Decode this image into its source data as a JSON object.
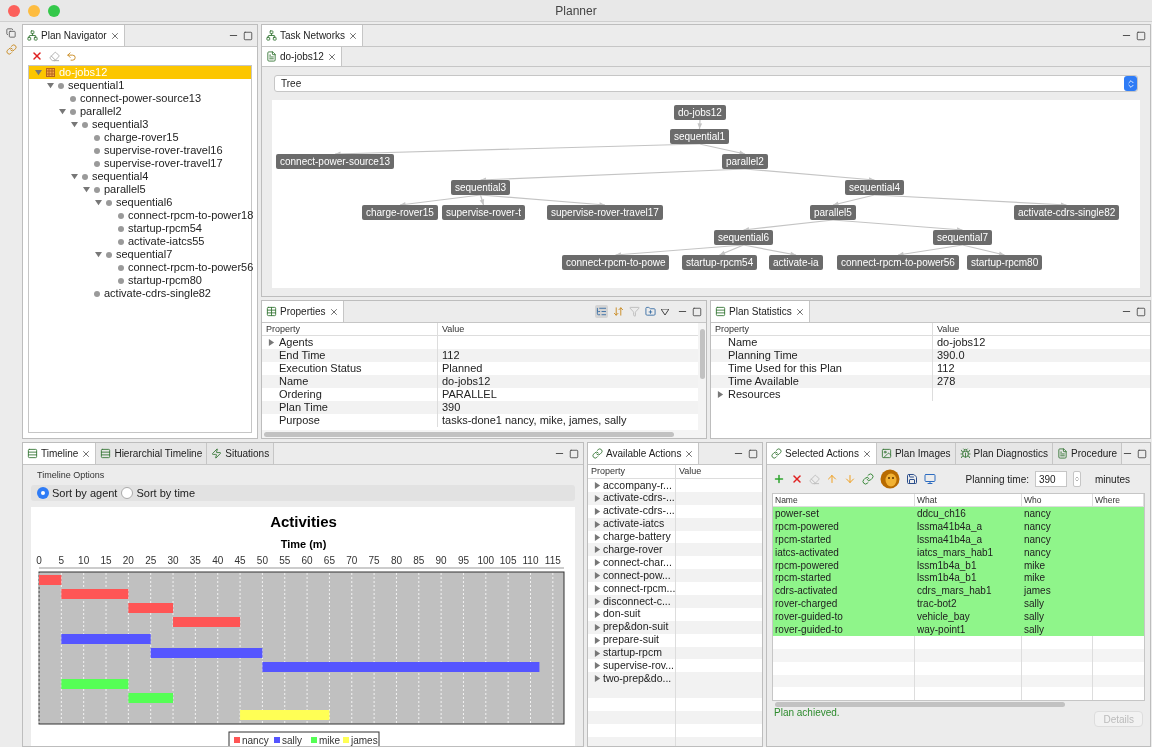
{
  "window": {
    "title": "Planner"
  },
  "plan_navigator": {
    "tabs": [
      {
        "label": "Plan Navigator",
        "selected": true
      }
    ],
    "tree": [
      {
        "label": "do-jobs12",
        "kind": "plan",
        "selected": true,
        "expanded": true,
        "children": [
          {
            "label": "sequential1",
            "kind": "task",
            "selected": false,
            "expanded": true,
            "children": [
              {
                "label": "connect-power-source13",
                "kind": "task",
                "selected": false
              },
              {
                "label": "parallel2",
                "kind": "task",
                "selected": false,
                "expanded": true,
                "children": [
                  {
                    "label": "sequential3",
                    "kind": "task",
                    "selected": false,
                    "expanded": true,
                    "children": [
                      {
                        "label": "charge-rover15",
                        "kind": "task",
                        "selected": false
                      },
                      {
                        "label": "supervise-rover-travel16",
                        "kind": "task",
                        "selected": false
                      },
                      {
                        "label": "supervise-rover-travel17",
                        "kind": "task",
                        "selected": false
                      }
                    ]
                  },
                  {
                    "label": "sequential4",
                    "kind": "task",
                    "selected": false,
                    "expanded": true,
                    "children": [
                      {
                        "label": "parallel5",
                        "kind": "task",
                        "selected": false,
                        "expanded": true,
                        "children": [
                          {
                            "label": "sequential6",
                            "kind": "task",
                            "selected": false,
                            "expanded": true,
                            "children": [
                              {
                                "label": "connect-rpcm-to-power18",
                                "kind": "task",
                                "selected": false
                              },
                              {
                                "label": "startup-rpcm54",
                                "kind": "task",
                                "selected": false
                              },
                              {
                                "label": "activate-iatcs55",
                                "kind": "task",
                                "selected": false
                              }
                            ]
                          },
                          {
                            "label": "sequential7",
                            "kind": "task",
                            "selected": false,
                            "expanded": true,
                            "children": [
                              {
                                "label": "connect-rpcm-to-power56",
                                "kind": "task",
                                "selected": false
                              },
                              {
                                "label": "startup-rpcm80",
                                "kind": "task",
                                "selected": false
                              }
                            ]
                          }
                        ]
                      },
                      {
                        "label": "activate-cdrs-single82",
                        "kind": "task",
                        "selected": false
                      }
                    ]
                  }
                ]
              }
            ]
          }
        ]
      }
    ]
  },
  "task_networks": {
    "tabs": [
      {
        "label": "Task Networks",
        "selected": true
      }
    ],
    "editor_tabs": [
      {
        "label": "do-jobs12",
        "selected": true
      }
    ],
    "view_select": {
      "value": "Tree"
    },
    "graph": {
      "label": "do-jobs12",
      "children": [
        {
          "label": "sequential1",
          "children": [
            {
              "label": "connect-power-source13"
            },
            {
              "label": "parallel2",
              "children": [
                {
                  "label": "sequential3",
                  "children": [
                    {
                      "label": "charge-rover15"
                    },
                    {
                      "label": "supervise-rover-t"
                    },
                    {
                      "label": "supervise-rover-travel17"
                    }
                  ]
                },
                {
                  "label": "sequential4",
                  "children": [
                    {
                      "label": "parallel5",
                      "children": [
                        {
                          "label": "sequential6",
                          "children": [
                            {
                              "label": "connect-rpcm-to-powe"
                            },
                            {
                              "label": "startup-rpcm54"
                            },
                            {
                              "label": "activate-ia"
                            }
                          ]
                        },
                        {
                          "label": "sequential7",
                          "children": [
                            {
                              "label": "connect-rpcm-to-power56"
                            },
                            {
                              "label": "startup-rpcm80"
                            }
                          ]
                        }
                      ]
                    },
                    {
                      "label": "activate-cdrs-single82"
                    }
                  ]
                }
              ]
            }
          ]
        }
      ]
    }
  },
  "properties": {
    "tabs": [
      {
        "label": "Properties",
        "selected": true
      }
    ],
    "columns": [
      "Property",
      "Value"
    ],
    "rows": [
      {
        "kind": "group",
        "property": "Agents",
        "expanded": false
      },
      {
        "kind": "field",
        "property": "End Time",
        "value": "112"
      },
      {
        "kind": "field",
        "property": "Execution Status",
        "value": "Planned"
      },
      {
        "kind": "field",
        "property": "Name",
        "value": "do-jobs12"
      },
      {
        "kind": "field",
        "property": "Ordering",
        "value": "PARALLEL"
      },
      {
        "kind": "field",
        "property": "Plan Time",
        "value": "390"
      },
      {
        "kind": "field",
        "property": "Purpose",
        "value": "tasks-done1 nancy, mike, james, sally"
      }
    ]
  },
  "plan_statistics": {
    "tabs": [
      {
        "label": "Plan Statistics",
        "selected": true
      }
    ],
    "columns": [
      "Property",
      "Value"
    ],
    "rows": [
      {
        "kind": "field",
        "property": "Name",
        "value": "do-jobs12"
      },
      {
        "kind": "field",
        "property": "Planning Time",
        "value": "390.0"
      },
      {
        "kind": "field",
        "property": "Time Used for this Plan",
        "value": "112"
      },
      {
        "kind": "field",
        "property": "Time Available",
        "value": "278"
      },
      {
        "kind": "group",
        "property": "Resources",
        "expanded": false
      }
    ]
  },
  "timeline": {
    "tabs": [
      {
        "label": "Timeline",
        "selected": true
      },
      {
        "label": "Hierarchial Timeline",
        "selected": false
      },
      {
        "label": "Situations",
        "selected": false
      }
    ],
    "options_label": "Timeline Options",
    "sort_options": [
      {
        "label": "Sort by agent",
        "selected": true
      },
      {
        "label": "Sort by time",
        "selected": false
      }
    ],
    "chart": {
      "title": "Activities",
      "axis_title": "Time (m)",
      "ticks": [
        "0",
        "5",
        "10",
        "15",
        "20",
        "25",
        "30",
        "35",
        "40",
        "45",
        "50",
        "55",
        "60",
        "65",
        "70",
        "75",
        "80",
        "85",
        "90",
        "95",
        "100",
        "105",
        "110",
        "115"
      ],
      "legend": [
        {
          "name": "nancy",
          "color": "#ff5555"
        },
        {
          "name": "sally",
          "color": "#5555ff"
        },
        {
          "name": "mike",
          "color": "#55ff55"
        },
        {
          "name": "james",
          "color": "#ffff55"
        }
      ]
    }
  },
  "available_actions": {
    "tabs": [
      {
        "label": "Available Actions",
        "selected": true
      }
    ],
    "columns": [
      "Property",
      "Value"
    ],
    "items": [
      {
        "label": "accompany-r...",
        "expanded": false
      },
      {
        "label": "activate-cdrs-...",
        "expanded": false
      },
      {
        "label": "activate-cdrs-...",
        "expanded": false
      },
      {
        "label": "activate-iatcs",
        "expanded": false
      },
      {
        "label": "charge-battery",
        "expanded": false
      },
      {
        "label": "charge-rover",
        "expanded": false
      },
      {
        "label": "connect-char...",
        "expanded": false
      },
      {
        "label": "connect-pow...",
        "expanded": false
      },
      {
        "label": "connect-rpcm...",
        "expanded": false
      },
      {
        "label": "disconnect-c...",
        "expanded": false
      },
      {
        "label": "don-suit",
        "expanded": false
      },
      {
        "label": "prep&don-suit",
        "expanded": false
      },
      {
        "label": "prepare-suit",
        "expanded": false
      },
      {
        "label": "startup-rpcm",
        "expanded": false
      },
      {
        "label": "supervise-rov...",
        "expanded": false
      },
      {
        "label": "two-prep&do...",
        "expanded": false
      }
    ]
  },
  "selected_actions": {
    "tabs": [
      {
        "label": "Selected Actions",
        "selected": true
      },
      {
        "label": "Plan Images",
        "selected": false
      },
      {
        "label": "Plan Diagnostics",
        "selected": false
      },
      {
        "label": "Procedure",
        "selected": false
      }
    ],
    "planning_time": {
      "label": "Planning time:",
      "value": "390",
      "unit": "minutes"
    },
    "columns": [
      "Name",
      "What",
      "Who",
      "Where"
    ],
    "rows": [
      {
        "name": "power-set",
        "what": "ddcu_ch16",
        "who": "nancy",
        "achieved": true
      },
      {
        "name": "rpcm-powered",
        "what": "lssma41b4a_a",
        "who": "nancy",
        "achieved": true
      },
      {
        "name": "rpcm-started",
        "what": "lssma41b4a_a",
        "who": "nancy",
        "achieved": true
      },
      {
        "name": "iatcs-activated",
        "what": "iatcs_mars_hab1",
        "who": "nancy",
        "achieved": true
      },
      {
        "name": "rpcm-powered",
        "what": "lssm1b4a_b1",
        "who": "mike",
        "achieved": true
      },
      {
        "name": "rpcm-started",
        "what": "lssm1b4a_b1",
        "who": "mike",
        "achieved": true
      },
      {
        "name": "cdrs-activated",
        "what": "cdrs_mars_hab1",
        "who": "james",
        "achieved": true
      },
      {
        "name": "rover-charged",
        "what": "trac-bot2",
        "who": "sally",
        "achieved": true
      },
      {
        "name": "rover-guided-to",
        "what": "vehicle_bay",
        "who": "sally",
        "achieved": true
      },
      {
        "name": "rover-guided-to",
        "what": "way-point1",
        "who": "sally",
        "achieved": true
      }
    ],
    "status": "Plan achieved.",
    "details_button": {
      "label": "Details",
      "disabled": true
    }
  }
}
